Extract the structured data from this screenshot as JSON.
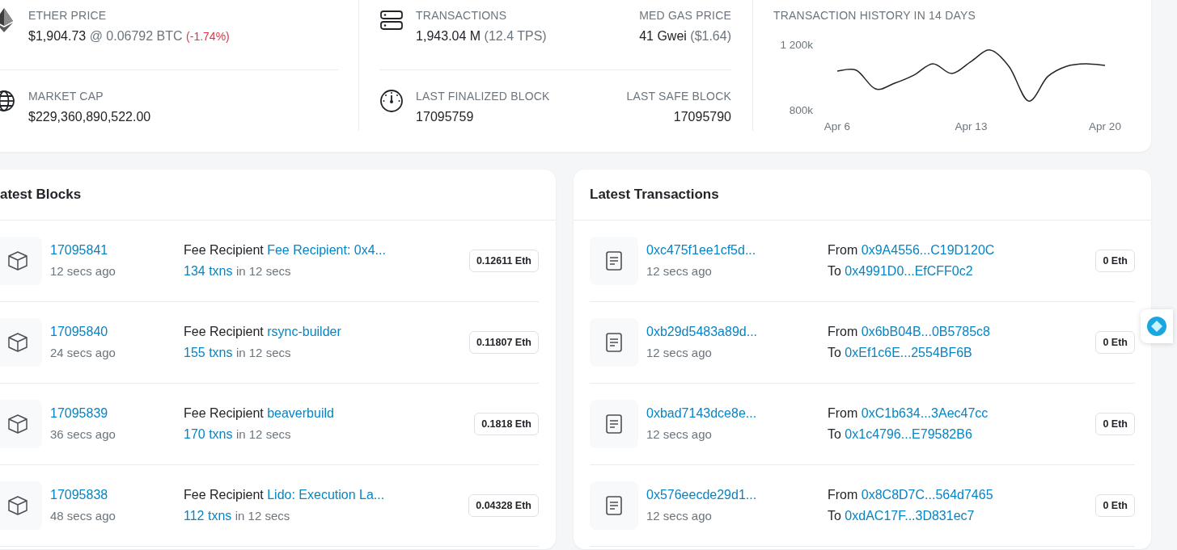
{
  "stats": {
    "ether_price": {
      "label": "ETHER PRICE",
      "price": "$1,904.73",
      "btc": "@ 0.06792 BTC",
      "change": "(-1.74%)"
    },
    "market_cap": {
      "label": "MARKET CAP",
      "value": "$229,360,890,522.00"
    },
    "transactions": {
      "label": "TRANSACTIONS",
      "value": "1,943.04 M",
      "tps": "(12.4 TPS)"
    },
    "med_gas_price": {
      "label": "MED GAS PRICE",
      "value": "41 Gwei",
      "usd": "($1.64)"
    },
    "last_finalized_block": {
      "label": "LAST FINALIZED BLOCK",
      "value": "17095759"
    },
    "last_safe_block": {
      "label": "LAST SAFE BLOCK",
      "value": "17095790"
    }
  },
  "chart": {
    "title": "TRANSACTION HISTORY IN 14 DAYS",
    "chart_data": {
      "type": "line",
      "categories": [
        "Apr 6",
        null,
        null,
        null,
        null,
        null,
        null,
        "Apr 13",
        null,
        null,
        null,
        null,
        null,
        null,
        "Apr 20"
      ],
      "series": [
        {
          "color": "#212529",
          "values": [
            1037000,
            1042000,
            928000,
            963000,
            1012000,
            1082000,
            1022000,
            1096000,
            1166000,
            1062000,
            854000,
            1003000,
            1067000,
            1082000,
            1072000
          ]
        }
      ],
      "ylim": [
        800000,
        1200000
      ],
      "yticks": [
        {
          "value": 800000,
          "label": "800k"
        },
        {
          "value": 1200000,
          "label": "1 200k"
        }
      ]
    }
  },
  "latest_blocks": {
    "title": "atest Blocks",
    "rows": [
      {
        "block": "17095841",
        "age": "12 secs ago",
        "fee_label": "Fee Recipient",
        "fee_recipient": "Fee Recipient: 0x4...",
        "txns": "134 txns",
        "txns_suffix": "in 12 secs",
        "reward": "0.12611 Eth"
      },
      {
        "block": "17095840",
        "age": "24 secs ago",
        "fee_label": "Fee Recipient",
        "fee_recipient": "rsync-builder",
        "txns": "155 txns",
        "txns_suffix": "in 12 secs",
        "reward": "0.11807 Eth"
      },
      {
        "block": "17095839",
        "age": "36 secs ago",
        "fee_label": "Fee Recipient",
        "fee_recipient": "beaverbuild",
        "txns": "170 txns",
        "txns_suffix": "in 12 secs",
        "reward": "0.1818 Eth"
      },
      {
        "block": "17095838",
        "age": "48 secs ago",
        "fee_label": "Fee Recipient",
        "fee_recipient": "Lido: Execution La...",
        "txns": "112 txns",
        "txns_suffix": "in 12 secs",
        "reward": "0.04328 Eth"
      }
    ]
  },
  "latest_transactions": {
    "title": "Latest Transactions",
    "rows": [
      {
        "hash": "0xc475f1ee1cf5d...",
        "age": "12 secs ago",
        "from_label": "From",
        "from": "0x9A4556...C19D120C",
        "to_label": "To",
        "to": "0x4991D0...EfCFF0c2",
        "value": "0 Eth"
      },
      {
        "hash": "0xb29d5483a89d...",
        "age": "12 secs ago",
        "from_label": "From",
        "from": "0x6bB04B...0B5785c8",
        "to_label": "To",
        "to": "0xEf1c6E...2554BF6B",
        "value": "0 Eth"
      },
      {
        "hash": "0xbad7143dce8e...",
        "age": "12 secs ago",
        "from_label": "From",
        "from": "0xC1b634...3Aec47cc",
        "to_label": "To",
        "to": "0x1c4796...E79582B6",
        "value": "0 Eth"
      },
      {
        "hash": "0x576eecde29d1...",
        "age": "12 secs ago",
        "from_label": "From",
        "from": "0x8C8D7C...564d7465",
        "to_label": "To",
        "to": "0xdAC17F...3D831ec7",
        "value": "0 Eth"
      }
    ]
  }
}
